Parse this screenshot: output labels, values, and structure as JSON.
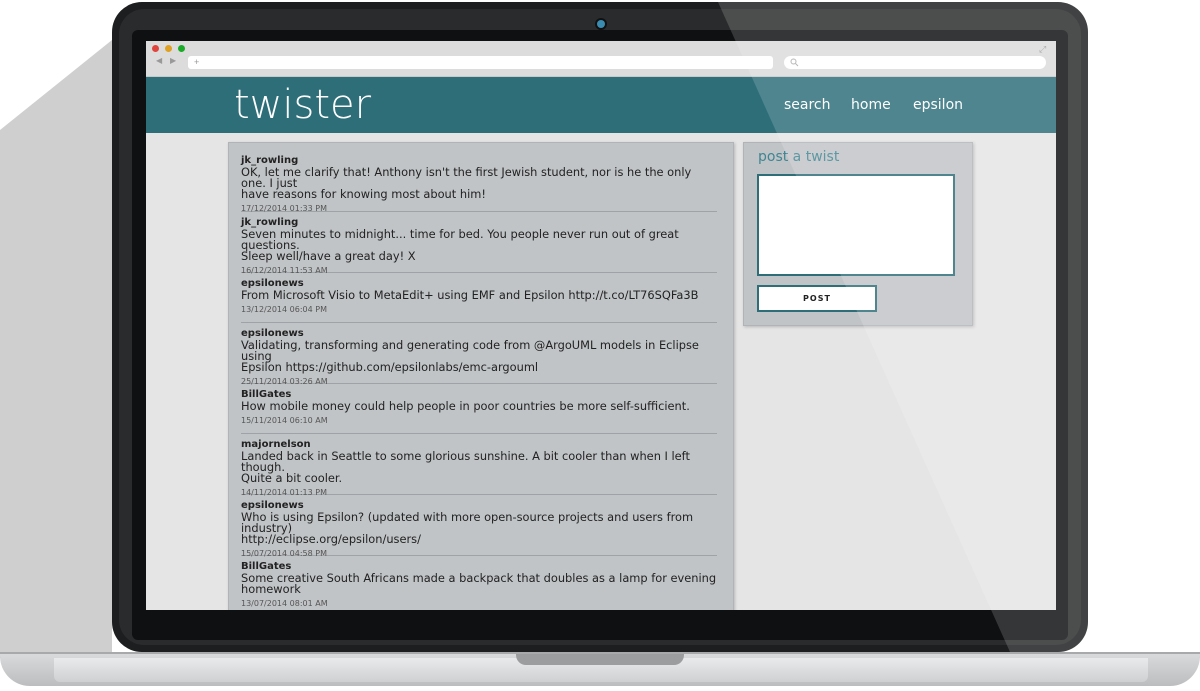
{
  "browser": {
    "url": "+",
    "search_icon": "search-icon",
    "back": "◀",
    "forward": "▶",
    "expand": "⤢",
    "traffic_lights": [
      "#e0443e",
      "#dea123",
      "#1aab29"
    ]
  },
  "site": {
    "logo": "twister",
    "nav": [
      "search",
      "home",
      "epsilon"
    ],
    "accent": "#2d6e79"
  },
  "feed": [
    {
      "user": "jk_rowling",
      "text": "OK, let me clarify that! Anthony isn't the first Jewish student, nor is he the only one. I just\nhave reasons for knowing most about him!",
      "time": "17/12/2014 01:33 PM"
    },
    {
      "user": "jk_rowling",
      "text": "Seven minutes to midnight... time for bed. You people never run out of great questions.\nSleep well/have a great day! X",
      "time": "16/12/2014 11:53 AM"
    },
    {
      "user": "epsilonews",
      "text": "From Microsoft Visio to MetaEdit+ using EMF and Epsilon http://t.co/LT76SQFa3B",
      "time": "13/12/2014 06:04 PM"
    },
    {
      "user": "epsilonews",
      "text": "Validating, transforming and generating code from @ArgoUML models in Eclipse using\nEpsilon https://github.com/epsilonlabs/emc-argouml",
      "time": "25/11/2014 03:26 AM"
    },
    {
      "user": "BillGates",
      "text": "How mobile money could help people in poor countries be more self-sufficient.",
      "time": "15/11/2014 06:10 AM"
    },
    {
      "user": "majornelson",
      "text": "Landed back in Seattle to some glorious sunshine. A bit cooler than when I left though.\nQuite a bit cooler.",
      "time": "14/11/2014 01:13 PM"
    },
    {
      "user": "epsilonews",
      "text": "Who is using Epsilon? (updated with more open-source projects and users from industry)\nhttp://eclipse.org/epsilon/users/",
      "time": "15/07/2014 04:58 PM"
    },
    {
      "user": "BillGates",
      "text": "Some creative South Africans made a backpack that doubles as a lamp for evening\nhomework",
      "time": "13/07/2014 08:01 AM"
    }
  ],
  "post_box": {
    "title": "post a twist",
    "button": "POST"
  }
}
